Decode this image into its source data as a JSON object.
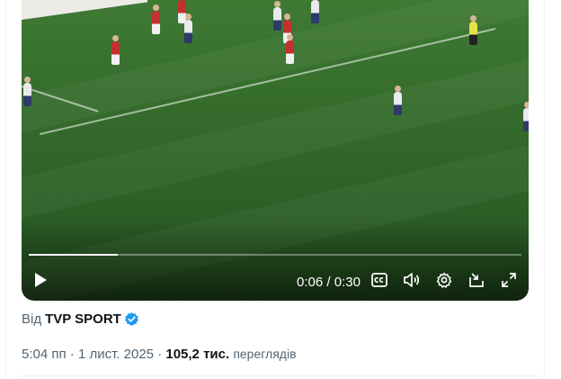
{
  "video": {
    "progress_fraction": 0.18,
    "time_current": "0:06",
    "time_separator": "/",
    "time_total": "0:30",
    "controls": [
      "play-icon",
      "captions-icon",
      "volume-icon",
      "settings-icon",
      "dock-icon",
      "fullscreen-icon"
    ]
  },
  "source": {
    "prefix": "Від",
    "name": "TVP SPORT"
  },
  "meta": {
    "time": "5:04 пп",
    "dot1": "·",
    "date": "1 лист. 2025",
    "dot2": "·",
    "views_count": "105,2 тис.",
    "views_label": "переглядів"
  },
  "colors": {
    "text_primary": "#0f1419",
    "text_secondary": "#536471",
    "verified_blue": "#1d9bf0",
    "pitch_green": "#356c2c"
  }
}
